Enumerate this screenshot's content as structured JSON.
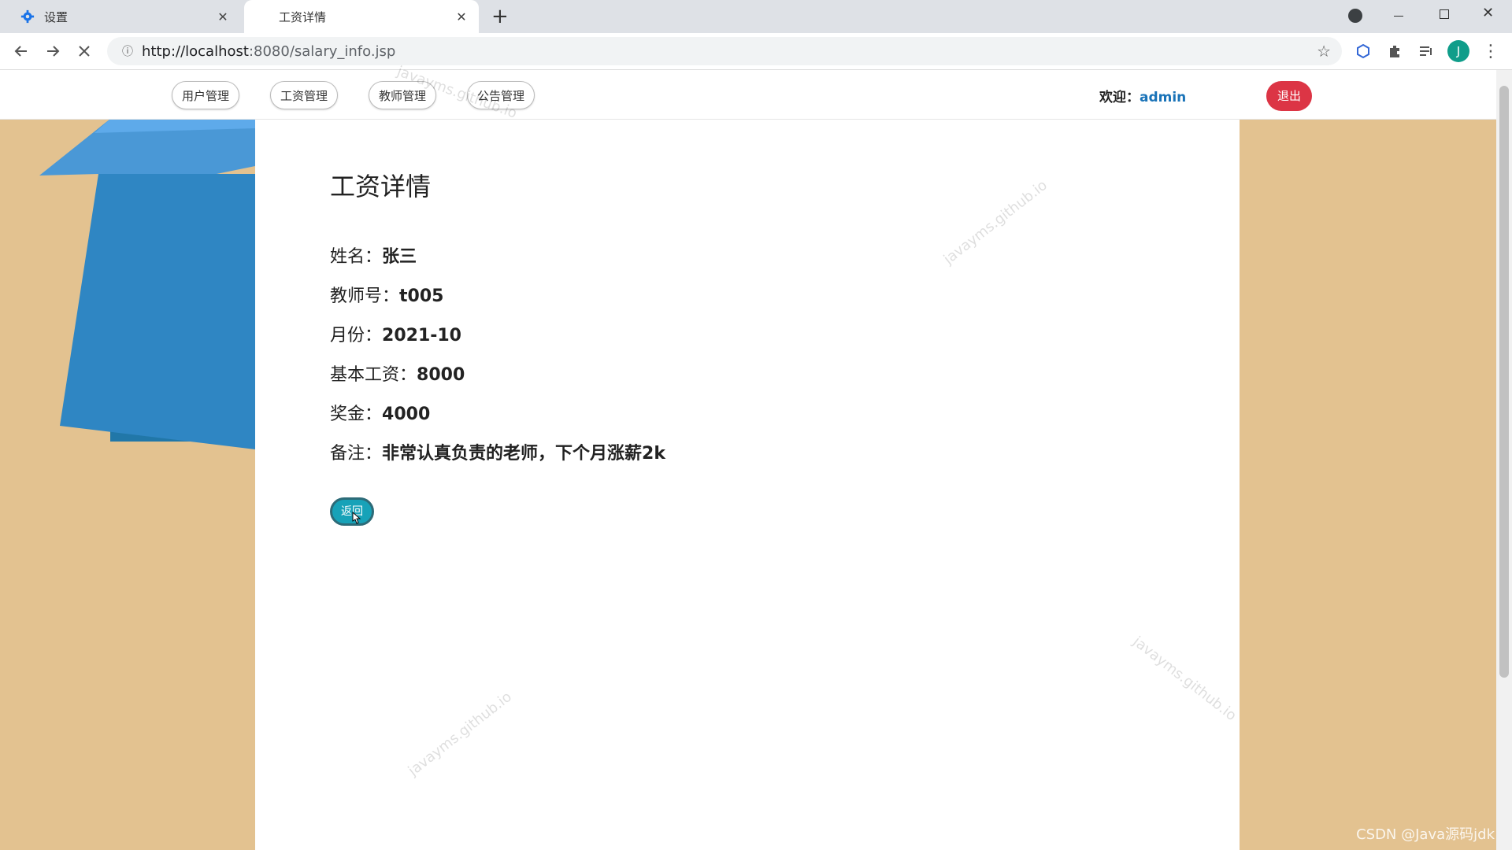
{
  "browser": {
    "tabs": [
      {
        "title": "设置",
        "icon": "gear-icon"
      },
      {
        "title": "工资详情"
      }
    ],
    "url_host": "http://localhost",
    "url_path": ":8080/salary_info.jsp",
    "profile_initial": "J",
    "close_glyph": "✕",
    "new_tab_glyph": "+"
  },
  "nav": {
    "items": [
      "用户管理",
      "工资管理",
      "教师管理",
      "公告管理"
    ],
    "welcome_label": "欢迎：",
    "username": "admin",
    "logout": "退出"
  },
  "salary": {
    "title": "工资详情",
    "fields": [
      {
        "label": "姓名：",
        "value": "张三"
      },
      {
        "label": "教师号：",
        "value": "t005"
      },
      {
        "label": "月份：",
        "value": "2021-10"
      },
      {
        "label": "基本工资：",
        "value": "8000"
      },
      {
        "label": "奖金：",
        "value": "4000"
      },
      {
        "label": "备注：",
        "value": "非常认真负责的老师，下个月涨薪2k"
      }
    ],
    "back_button": "返回"
  },
  "watermark": "javayms.github.io",
  "footer_credit": "CSDN @Java源码jdk",
  "colors": {
    "accent": "#17a2b8",
    "danger": "#dc3545",
    "background": "#e3c290",
    "box_blue": "#2f86c3"
  }
}
